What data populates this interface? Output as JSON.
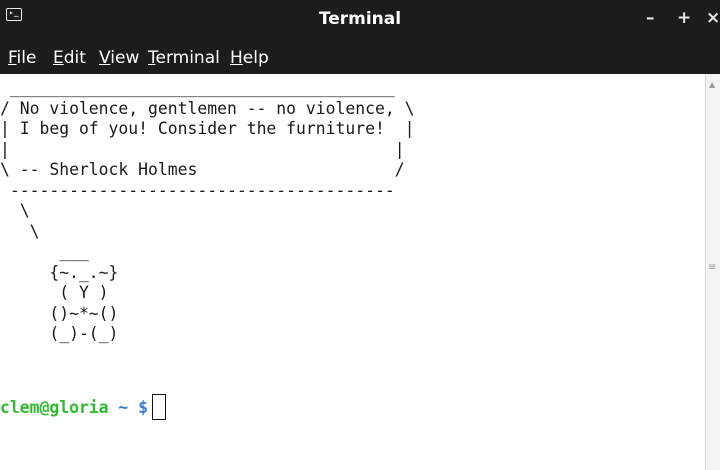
{
  "window": {
    "title": "Terminal",
    "icon": "terminal-icon",
    "controls": {
      "minimize": "–",
      "maximize": "+",
      "close": "×"
    }
  },
  "menubar": {
    "items": [
      {
        "mnemonic": "F",
        "rest": "ile"
      },
      {
        "mnemonic": "E",
        "rest": "dit"
      },
      {
        "mnemonic": "V",
        "rest": "iew"
      },
      {
        "mnemonic": "T",
        "rest": "erminal"
      },
      {
        "mnemonic": "H",
        "rest": "elp"
      }
    ]
  },
  "terminal": {
    "output": " _______________________________________\n/ No violence, gentlemen -- no violence, \\\n| I beg of you! Consider the furniture!  |\n|                                       |\n\\ -- Sherlock Holmes                    /\n ---------------------------------------\n  \\\n   \\\n      ___\n     {~._.~}\n      ( Y )\n     ()~*~()\n     (_)-(_)",
    "prompt": {
      "user_host": "clem@gloria",
      "dir": " ~ $",
      "input": ""
    }
  },
  "colors": {
    "titlebar_bg": "#1c1c1c",
    "prompt_user": "#2ebd2e",
    "prompt_dir": "#3579e0",
    "terminal_bg": "#ffffff"
  }
}
